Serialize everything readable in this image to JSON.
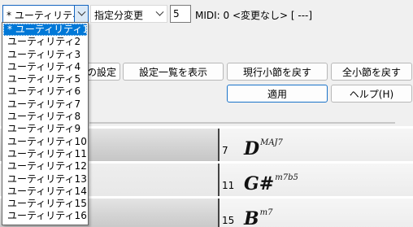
{
  "toolbar": {
    "utility_combo_value": "* ユーティリティ1",
    "mode_combo_value": "指定分変更",
    "number_value": "5",
    "midi_status": "MIDI: 0 <変更なし> [ ---]"
  },
  "buttons": {
    "settings_partial": "の設定",
    "show_settings_list": "設定一覧を表示",
    "reset_current_bar": "現行小節を戻す",
    "reset_all_bars": "全小節を戻す",
    "apply": "適用",
    "help": "ヘルプ(H)"
  },
  "dropdown": {
    "items": [
      "* ユーティリティ1 *",
      "ユーティリティ2",
      "ユーティリティ3",
      "ユーティリティ4",
      "ユーティリティ5",
      "ユーティリティ6",
      "ユーティリティ7",
      "ユーティリティ8",
      "ユーティリティ9",
      "ユーティリティ10",
      "ユーティリティ11",
      "ユーティリティ12",
      "ユーティリティ13",
      "ユーティリティ14",
      "ユーティリティ15",
      "ユーティリティ16"
    ]
  },
  "sheet": {
    "rows": [
      {
        "bar": "7",
        "chord_root": "D",
        "chord_ext": "MAJ7"
      },
      {
        "bar": "11",
        "chord_root": "G#",
        "chord_ext": "m7b5"
      },
      {
        "bar": "15",
        "chord_root": "B",
        "chord_ext": "m7"
      }
    ]
  }
}
